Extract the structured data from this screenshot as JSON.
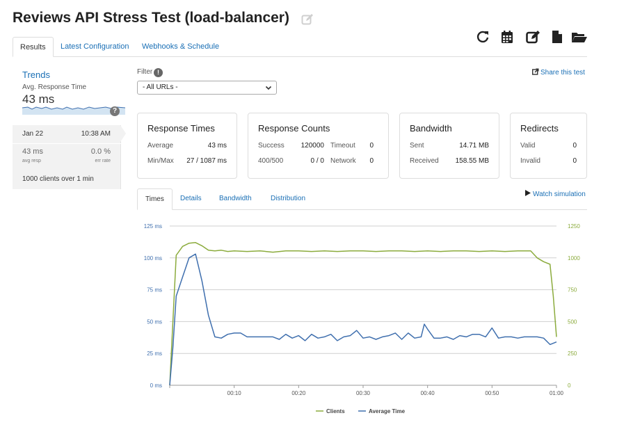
{
  "header": {
    "title": "Reviews API Stress Test (load-balancer)"
  },
  "toolbar": {
    "icons": [
      "refresh-icon",
      "calendar-icon",
      "edit-icon",
      "file-icon",
      "folder-open-icon"
    ]
  },
  "tabs": [
    {
      "label": "Results",
      "active": true
    },
    {
      "label": "Latest Configuration",
      "active": false
    },
    {
      "label": "Webhooks & Schedule",
      "active": false
    }
  ],
  "trends": {
    "title": "Trends",
    "subtitle": "Avg. Response Time",
    "value": "43 ms",
    "help": "?",
    "run": {
      "date": "Jan 22",
      "time": "10:38 AM",
      "avg_resp": "43 ms",
      "avg_resp_label": "avg resp",
      "err_rate": "0.0 %",
      "err_rate_label": "err rate",
      "clients_count": "1000",
      "clients_mid": " clients over ",
      "duration": "1 min"
    }
  },
  "filter": {
    "label": "Filter",
    "info": "!",
    "selected": "- All URLs -"
  },
  "share": {
    "label": "Share this test"
  },
  "cards": {
    "response_times": {
      "title": "Response Times",
      "average_label": "Average",
      "average_value": "43 ms",
      "minmax_label": "Min/Max",
      "minmax_value": "27 / 1087 ms"
    },
    "response_counts": {
      "title": "Response Counts",
      "success_label": "Success",
      "success_value": "120000",
      "timeout_label": "Timeout",
      "timeout_value": "0",
      "r400_label": "400/500",
      "r400_value": "0 / 0",
      "network_label": "Network",
      "network_value": "0"
    },
    "bandwidth": {
      "title": "Bandwidth",
      "sent_label": "Sent",
      "sent_value": "14.71 MB",
      "received_label": "Received",
      "received_value": "158.55 MB"
    },
    "redirects": {
      "title": "Redirects",
      "valid_label": "Valid",
      "valid_value": "0",
      "invalid_label": "Invalid",
      "invalid_value": "0"
    }
  },
  "subtabs": [
    {
      "label": "Times",
      "active": true
    },
    {
      "label": "Details",
      "active": false
    },
    {
      "label": "Bandwidth",
      "active": false
    },
    {
      "label": "Distribution",
      "active": false
    }
  ],
  "watch": {
    "label": "Watch simulation"
  },
  "colors": {
    "clients": "#8bab3c",
    "avg_time": "#3f6fae",
    "link": "#1a6fb5"
  },
  "chart_data": {
    "type": "line",
    "x_ticks": [
      "00:10",
      "00:20",
      "00:30",
      "00:40",
      "00:50",
      "01:00"
    ],
    "x_tick_values": [
      10,
      20,
      30,
      40,
      50,
      60
    ],
    "xlim": [
      0,
      60
    ],
    "y_left_ticks": [
      "0 ms",
      "25 ms",
      "50 ms",
      "75 ms",
      "100 ms",
      "125 ms"
    ],
    "y_left_values": [
      0,
      25,
      50,
      75,
      100,
      125
    ],
    "ylim_left": [
      0,
      125
    ],
    "y_right_ticks": [
      "0",
      "250",
      "500",
      "750",
      "1000",
      "1250"
    ],
    "y_right_values": [
      0,
      250,
      500,
      750,
      1000,
      1250
    ],
    "ylim_right": [
      0,
      1250
    ],
    "grid": true,
    "legend": "bottom",
    "series": [
      {
        "name": "Clients",
        "axis": "right",
        "x": [
          0,
          1,
          2,
          3,
          4,
          5,
          6,
          7,
          8,
          9,
          10,
          12,
          14,
          16,
          18,
          20,
          22,
          24,
          26,
          28,
          30,
          32,
          34,
          36,
          38,
          40,
          42,
          44,
          46,
          48,
          50,
          52,
          54,
          56,
          57,
          58,
          59,
          59.5,
          60
        ],
        "values": [
          0,
          1020,
          1090,
          1115,
          1120,
          1095,
          1060,
          1055,
          1060,
          1050,
          1055,
          1050,
          1055,
          1045,
          1055,
          1055,
          1050,
          1055,
          1050,
          1055,
          1055,
          1050,
          1055,
          1055,
          1050,
          1055,
          1050,
          1055,
          1055,
          1050,
          1055,
          1050,
          1055,
          1055,
          1000,
          970,
          950,
          700,
          380
        ]
      },
      {
        "name": "Average Time",
        "axis": "left",
        "x": [
          0,
          0.5,
          1,
          2,
          3,
          4,
          5,
          6,
          7,
          8,
          9,
          10,
          11,
          12,
          14,
          16,
          17,
          18,
          19,
          20,
          21,
          22,
          23,
          24,
          25,
          26,
          27,
          28,
          29,
          30,
          31,
          32,
          33,
          34,
          35,
          36,
          37,
          38,
          39,
          39.5,
          40,
          41,
          42,
          43,
          44,
          45,
          46,
          47,
          48,
          49,
          50,
          51,
          52,
          53,
          54,
          55,
          56,
          57,
          58,
          59,
          60
        ],
        "values": [
          0,
          30,
          70,
          85,
          100,
          103,
          82,
          55,
          38,
          37,
          40,
          41,
          41,
          38,
          38,
          38,
          36,
          40,
          37,
          39,
          35,
          40,
          37,
          38,
          40,
          35,
          38,
          39,
          43,
          37,
          38,
          36,
          38,
          39,
          41,
          36,
          41,
          37,
          38,
          48,
          44,
          37,
          37,
          38,
          36,
          39,
          38,
          40,
          40,
          38,
          45,
          37,
          38,
          38,
          37,
          38,
          38,
          38,
          37,
          32,
          34
        ]
      }
    ]
  }
}
